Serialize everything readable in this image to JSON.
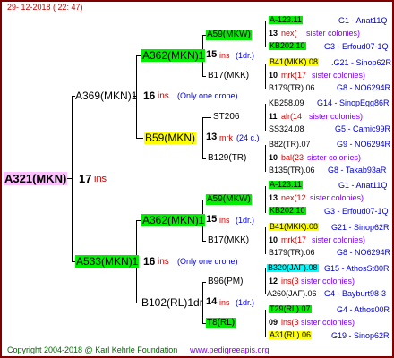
{
  "header": {
    "date": "29- 12-2018 ( 22: 47)"
  },
  "footer": {
    "copyright": "Copyright 2004-2018 @ Karl Kehrle Foundation",
    "url": "www.pedigreeapis.org"
  },
  "root": {
    "name": "A321(MKN)",
    "ins": "17",
    "ins_label": "ins"
  },
  "gen1": [
    {
      "name": "A369(MKN)1",
      "ins": "16",
      "ins_label": "ins",
      "note": "(Only one drone)"
    },
    {
      "name": "A533(MKN)1",
      "ins": "16",
      "ins_label": "ins",
      "note": "(Only one drone)"
    }
  ],
  "gen2": [
    {
      "name": "A362(MKN)1",
      "ins": "15",
      "ins_label": "ins",
      "note": "(1dr.)"
    },
    {
      "name": "B59(MKN)",
      "ins": "13",
      "ins_label": "mrk",
      "note": "(24 c.)"
    },
    {
      "name": "A362(MKN)1",
      "ins": "15",
      "ins_label": "ins",
      "note": "(1dr.)"
    },
    {
      "name": "B102(RL)1dr",
      "ins": "14",
      "ins_label": "ins",
      "note": "(1dr.)"
    }
  ],
  "gen3": [
    "A59(MKW)",
    "B17(MKK)",
    "ST206",
    "B129(TR)",
    "A59(MKW)",
    "B17(MKK)",
    "B96(PM)",
    "T8(RL)"
  ],
  "right": [
    {
      "name": "A-123.11",
      "loc": "G1 - Anat11Q"
    },
    {
      "count": "13",
      "text": "sister colonies)",
      "pre": "nex("
    },
    {
      "name": "KB202.10",
      "loc": "G3 - Erfoud07-1Q"
    },
    {
      "name": "B41(MKK).08",
      "loc": ".G21 - Sinop62R"
    },
    {
      "count": "10",
      "text": "sister colonies)",
      "pre": "mrk(17"
    },
    {
      "name": "B179(TR).06",
      "loc": "G8 - NO6294R"
    },
    {
      "name": "KB258.09",
      "loc": "G14 - SinopEgg86R"
    },
    {
      "count": "11",
      "text": "sister colonies)",
      "pre": "alr(14"
    },
    {
      "name": "SS324.08",
      "loc": "G5 - Camic99R"
    },
    {
      "name": "B82(TR).07",
      "loc": "G9 - NO6294R"
    },
    {
      "count": "10",
      "text": "sister colonies)",
      "pre": "bal(23"
    },
    {
      "name": "B135(TR).06",
      "loc": "G8 - Takab93aR"
    },
    {
      "name": "A-123.11",
      "loc": "G1 - Anat11Q"
    },
    {
      "count": "13",
      "text": "sister colonies)",
      "pre": "nex(12"
    },
    {
      "name": "KB202.10",
      "loc": "G3 - Erfoud07-1Q"
    },
    {
      "name": "B41(MKK).08",
      "loc": "G21 - Sinop62R"
    },
    {
      "count": "10",
      "text": "sister colonies)",
      "pre": "mrk(17"
    },
    {
      "name": "B179(TR).06",
      "loc": "G8 - NO6294R"
    },
    {
      "name": "B320(JAF).08",
      "loc": "G15 - AthosSt80R"
    },
    {
      "count": "12",
      "text": "sister colonies)",
      "pre": "ins(3"
    },
    {
      "name": "A260(JAF).06",
      "loc": "G4 - Bayburt98-3"
    },
    {
      "name": "T29(RL).07",
      "loc": "G4 - Athos00R"
    },
    {
      "count": "09",
      "text": "sister colonies)",
      "pre": "ins(3"
    },
    {
      "name": "A31(RL).06",
      "loc": "G19 - Sinop62R"
    }
  ]
}
